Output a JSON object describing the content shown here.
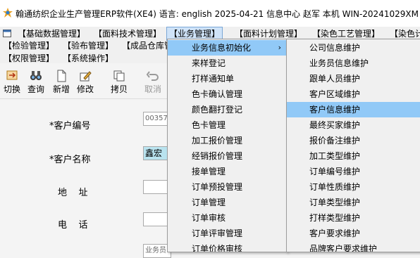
{
  "window": {
    "title": "翰通纺织企业生产管理ERP软件(XE4)  语言: english  2025-04-21  信息中心 赵军 本机 WIN-20241029XM"
  },
  "menubar": {
    "row1": [
      "【基础数据管理】",
      "【面料技术管理】",
      "【业务管理】",
      "【面料计划管理】",
      "【染色工艺管理】",
      "【染色计"
    ],
    "row2": [
      "【检验管理】",
      "【验布管理】",
      "【成品仓库管"
    ],
    "row3": [
      "【权限管理】",
      "【系统操作】"
    ]
  },
  "toolbar": {
    "switch": "切换",
    "query": "查询",
    "new": "新增",
    "edit": "修改",
    "copy": "拷贝",
    "cancel": "取消"
  },
  "form": {
    "customer_code_label": "*客户编号",
    "customer_code_value": "00357",
    "customer_name_label": "*客户名称",
    "customer_name_value": "鑫宏",
    "address_label": "地    址",
    "phone_label": "电    话",
    "partial_value": "业务员"
  },
  "submenu1": {
    "items": [
      "业务信息初始化",
      "来样登记",
      "打样通知单",
      "色卡确认管理",
      "颜色翻打登记",
      "色卡管理",
      "加工报价管理",
      "经销报价管理",
      "接单管理",
      "订单预投管理",
      "订单管理",
      "订单审核",
      "订单评审管理",
      "订单价格审核"
    ],
    "arrow": "›"
  },
  "submenu2": {
    "items": [
      "公司信息维护",
      "业务员信息维护",
      "跟单人员维护",
      "客户区域维护",
      "客户信息维护",
      "最终买家维护",
      "报价备注维护",
      "加工类型维护",
      "订单编号维护",
      "订单性质维护",
      "订单类型维护",
      "打样类型维护",
      "客户要求维护",
      "品牌客户要求维护"
    ]
  },
  "colors": {
    "menu_bg": "#f0f0f0",
    "selected": "#91c9f7",
    "active_menu": "#cfe3f8",
    "highlight_input": "#b9e3ef"
  }
}
